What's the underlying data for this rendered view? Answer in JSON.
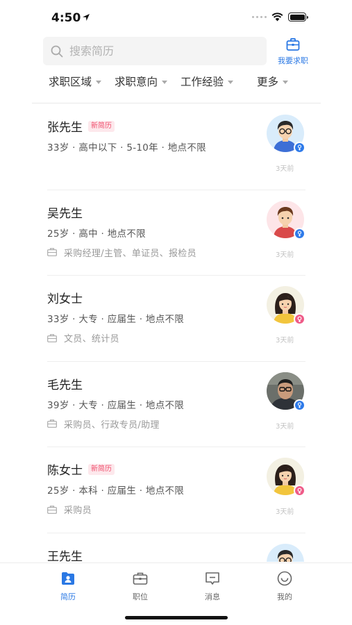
{
  "status": {
    "time": "4:50"
  },
  "search": {
    "placeholder": "搜索简历"
  },
  "job_button": {
    "label": "我要求职"
  },
  "filters": [
    "求职区域",
    "求职意向",
    "工作经验",
    "更多"
  ],
  "colors": {
    "accent": "#2a78e4",
    "male": "#2f7bea",
    "female": "#ef5b88",
    "badge": "#f0506e"
  },
  "candidates": [
    {
      "name": "张先生",
      "badge": "新简历",
      "info": "33岁 · 高中以下 · 5-10年 · 地点不限",
      "intent": "",
      "time": "3天前",
      "gender": "male",
      "avatar": "man-glasses"
    },
    {
      "name": "吴先生",
      "badge": "",
      "info": "25岁 · 高中 · 地点不限",
      "intent": "采购经理/主管、单证员、报检员",
      "time": "3天前",
      "gender": "male",
      "avatar": "man-red"
    },
    {
      "name": "刘女士",
      "badge": "",
      "info": "33岁 · 大专 · 应届生 · 地点不限",
      "intent": "文员、统计员",
      "time": "3天前",
      "gender": "female",
      "avatar": "woman"
    },
    {
      "name": "毛先生",
      "badge": "",
      "info": "39岁 · 大专 · 应届生 · 地点不限",
      "intent": "采购员、行政专员/助理",
      "time": "3天前",
      "gender": "male",
      "avatar": "photo"
    },
    {
      "name": "陈女士",
      "badge": "新简历",
      "info": "25岁 · 本科 · 应届生 · 地点不限",
      "intent": "采购员",
      "time": "3天前",
      "gender": "female",
      "avatar": "woman"
    },
    {
      "name": "王先生",
      "badge": "",
      "info": "",
      "intent": "",
      "time": "",
      "gender": "male",
      "avatar": "man-glasses"
    }
  ],
  "tabs": [
    {
      "label": "简历",
      "icon": "resume-icon",
      "active": true
    },
    {
      "label": "职位",
      "icon": "briefcase-icon",
      "active": false
    },
    {
      "label": "消息",
      "icon": "message-icon",
      "active": false
    },
    {
      "label": "我的",
      "icon": "profile-icon",
      "active": false
    }
  ]
}
